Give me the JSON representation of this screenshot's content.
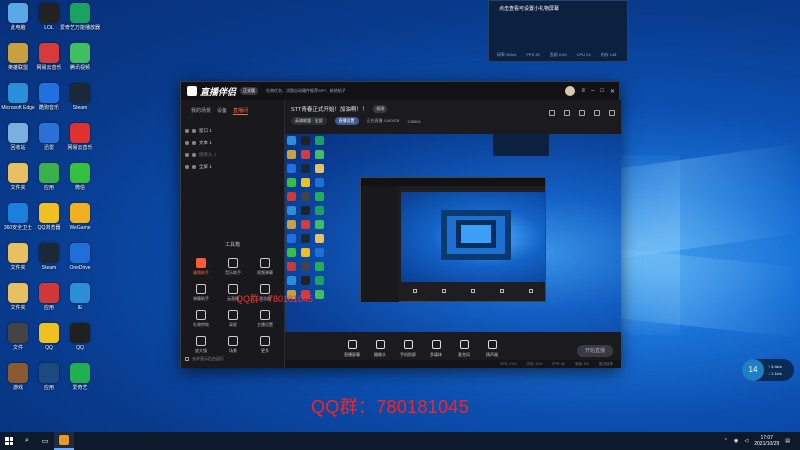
{
  "desktop": {
    "icons": [
      {
        "label": "此电脑",
        "color": "#5aa9e6"
      },
      {
        "label": "LOL",
        "color": "#222222"
      },
      {
        "label": "爱奇艺万能播放器",
        "color": "#1aa260"
      },
      {
        "label": "英雄联盟",
        "color": "#c8a040"
      },
      {
        "label": "网易云音乐",
        "color": "#d83a3a"
      },
      {
        "label": "腾讯视频",
        "color": "#3fbf5f"
      },
      {
        "label": "Microsoft Edge",
        "color": "#2a8ed8"
      },
      {
        "label": "酷狗音乐",
        "color": "#2070e0"
      },
      {
        "label": "Steam",
        "color": "#1b2838"
      },
      {
        "label": "回收站",
        "color": "#7ab0e0"
      },
      {
        "label": "迅雷",
        "color": "#2a70d6"
      },
      {
        "label": "网易云音乐",
        "color": "#e03030"
      },
      {
        "label": "文件夹",
        "color": "#e8c060"
      },
      {
        "label": "应用",
        "color": "#3ab04a"
      },
      {
        "label": "微信",
        "color": "#36c040"
      },
      {
        "label": "360安全卫士",
        "color": "#1b7fdc"
      },
      {
        "label": "QQ浏览器",
        "color": "#f0c020"
      },
      {
        "label": "WeGame",
        "color": "#f0b020"
      },
      {
        "label": "文件夹",
        "color": "#e8c060"
      },
      {
        "label": "Steam",
        "color": "#1b2838"
      },
      {
        "label": "OneDrive",
        "color": "#1f6fd6"
      },
      {
        "label": "文件夹",
        "color": "#e8c060"
      },
      {
        "label": "应用",
        "color": "#d03838"
      },
      {
        "label": "IE",
        "color": "#2a8ed8"
      },
      {
        "label": "文件",
        "color": "#444444"
      },
      {
        "label": "QQ",
        "color": "#f0c020"
      },
      {
        "label": "QQ",
        "color": "#202020"
      },
      {
        "label": "游戏",
        "color": "#8a5a30"
      },
      {
        "label": "应用",
        "color": "#1b4a80"
      },
      {
        "label": "爱奇艺",
        "color": "#20b050"
      }
    ]
  },
  "info_panel": {
    "title": "点击查看可设置小礼物屏幕",
    "stats": [
      "码率 0Kb/s",
      "FPS 30",
      "丢帧 0.00",
      "CPU 24",
      "内存 148"
    ]
  },
  "app": {
    "logo": "直播伴侣",
    "version_tag": "正式版",
    "notice": "礼物任务、试图自动硬件推荐SPF、新热帖子",
    "tabs": [
      "我的场景",
      "设备",
      "直播间"
    ],
    "active_tab": 2,
    "sources": [
      {
        "label": "窗口 1",
        "dim": false
      },
      {
        "label": "文本 1",
        "dim": false
      },
      {
        "label": "摄像头 1",
        "dim": true
      },
      {
        "label": "全屏 1",
        "dim": false
      }
    ],
    "toolbox_title": "工具箱",
    "tools": [
      {
        "label": "福袋助手",
        "hot": true
      },
      {
        "label": "音乐助手",
        "hot": false
      },
      {
        "label": "视频弹幕",
        "hot": false
      },
      {
        "label": "弹幕助手",
        "hot": false
      },
      {
        "label": "云直播",
        "hot": false
      },
      {
        "label": "浏览器",
        "hot": false
      },
      {
        "label": "礼物特效",
        "hot": false
      },
      {
        "label": "录屏",
        "hot": false
      },
      {
        "label": "主播设置",
        "hot": false
      },
      {
        "label": "放大镜",
        "hot": false
      },
      {
        "label": "场景",
        "hot": false
      },
      {
        "label": "更多",
        "hot": false
      }
    ],
    "bottom_option": "允许显示后台运行",
    "live_title": "STT青春正式开始！加油啊！！",
    "edit_label": "修改",
    "category": "英雄联盟 · 全部",
    "settings_btn": "直播设置",
    "viewers": "正在直播 4160078",
    "likes": "135804",
    "controls": [
      "直播屏幕",
      "摄像头",
      "手机投屏",
      "多媒体",
      "麦克风",
      "扬声器"
    ],
    "start_live": "开始直播",
    "status": [
      "CPU: 21%",
      "内存: 33%",
      "FPS: 60",
      "丢帧: 0%",
      "推流帧率"
    ]
  },
  "overlay": {
    "qq_small": "QQ群：780181045",
    "qq_big": "QQ群：780181045"
  },
  "badge": {
    "num": "14",
    "l1": "↑ 3.4k/s",
    "l2": "↓ 1.1k/s"
  },
  "taskbar": {
    "time": "17:07",
    "date": "2021/10/29"
  }
}
